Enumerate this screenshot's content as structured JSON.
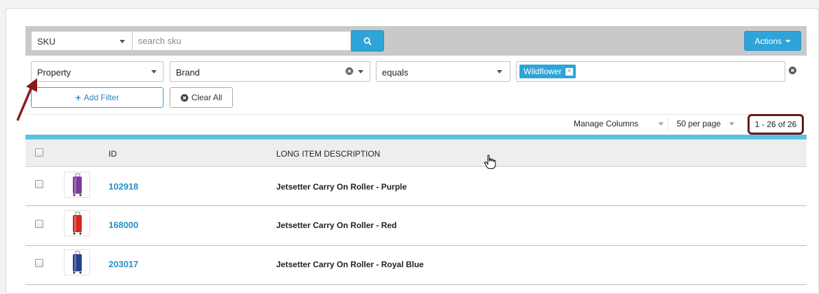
{
  "search": {
    "field_select": "SKU",
    "placeholder": "search sku",
    "actions_label": "Actions"
  },
  "filter": {
    "attribute": "Property",
    "property_value": "Brand",
    "operator": "equals",
    "tags": [
      "Wildflower"
    ],
    "add_filter_label": "Add Filter",
    "clear_all_label": "Clear All"
  },
  "toolbar": {
    "manage_columns": "Manage Columns",
    "per_page": "50 per page",
    "range": "1 - 26 of 26"
  },
  "table": {
    "headers": [
      "ID",
      "LONG ITEM DESCRIPTION"
    ],
    "rows": [
      {
        "id": "102918",
        "description": "Jetsetter Carry On Roller - Purple",
        "color": "#7b3a9e"
      },
      {
        "id": "168000",
        "description": "Jetsetter Carry On Roller - Red",
        "color": "#d3281f"
      },
      {
        "id": "203017",
        "description": "Jetsetter Carry On Roller - Royal Blue",
        "color": "#25408f"
      }
    ]
  },
  "colors": {
    "accent": "#2fa4d8",
    "highlight_box": "#6b1818",
    "annotation_arrow": "#8b1a1a"
  }
}
